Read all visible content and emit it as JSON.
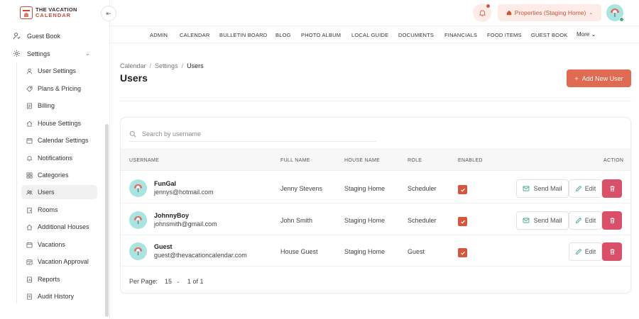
{
  "brand": {
    "line1": "THE VACATION",
    "line2": "CALENDAR"
  },
  "sidebar": {
    "top_items": [
      {
        "label": "Guest Book",
        "icon": "guest-book-icon"
      },
      {
        "label": "Settings",
        "icon": "gear-icon",
        "expanded": true
      }
    ],
    "sub_items": [
      {
        "label": "User Settings",
        "icon": "user-icon"
      },
      {
        "label": "Plans & Pricing",
        "icon": "tag-icon"
      },
      {
        "label": "Billing",
        "icon": "billing-icon"
      },
      {
        "label": "House Settings",
        "icon": "house-icon"
      },
      {
        "label": "Calendar Settings",
        "icon": "calendar-icon"
      },
      {
        "label": "Notifications",
        "icon": "bell-icon"
      },
      {
        "label": "Categories",
        "icon": "grid-icon"
      },
      {
        "label": "Users",
        "icon": "users-icon",
        "active": true
      },
      {
        "label": "Rooms",
        "icon": "room-icon"
      },
      {
        "label": "Additional Houses",
        "icon": "house-icon"
      },
      {
        "label": "Vacations",
        "icon": "calendar-icon"
      },
      {
        "label": "Vacation Approval",
        "icon": "check-calendar-icon"
      },
      {
        "label": "Reports",
        "icon": "report-icon"
      },
      {
        "label": "Audit History",
        "icon": "history-icon"
      }
    ]
  },
  "header": {
    "property_label": "Properties (Staging Home)",
    "menu": [
      "ADMIN",
      "CALENDAR",
      "BULLETIN BOARD",
      "BLOG",
      "PHOTO ALBUM",
      "LOCAL GUIDE",
      "DOCUMENTS",
      "FINANCIALS",
      "FOOD ITEMS",
      "GUEST BOOK"
    ],
    "more_label": "More"
  },
  "breadcrumb": [
    "Calendar",
    "Settings",
    "Users"
  ],
  "page_title": "Users",
  "add_button_label": "Add New User",
  "search": {
    "placeholder": "Search by username",
    "value": ""
  },
  "table": {
    "columns": [
      "USERNAME",
      "FULL NAME",
      "HOUSE NAME",
      "ROLE",
      "ENABLED",
      "ACTION"
    ],
    "rows": [
      {
        "username": "FunGal",
        "email": "jennys@hotmail.com",
        "full_name": "Jenny Stevens",
        "house": "Staging Home",
        "role": "Scheduler",
        "enabled": true,
        "actions": [
          "Send Mail",
          "Edit",
          "Delete"
        ]
      },
      {
        "username": "JohnnyBoy",
        "email": "johnsmith@gmail.com",
        "full_name": "John Smith",
        "house": "Staging Home",
        "role": "Scheduler",
        "enabled": true,
        "actions": [
          "Send Mail",
          "Edit",
          "Delete"
        ]
      },
      {
        "username": "Guest",
        "email": "guest@thevacationcalendar.com",
        "full_name": "House Guest",
        "house": "Staging Home",
        "role": "Guest",
        "enabled": true,
        "actions": [
          "Edit",
          "Delete"
        ]
      }
    ],
    "send_mail_label": "Send Mail",
    "edit_label": "Edit"
  },
  "pagination": {
    "per_page_label": "Per Page:",
    "per_page_value": "15",
    "page": "1",
    "of_label": "of",
    "total_pages": "1"
  },
  "colors": {
    "accent": "#df6b52",
    "danger": "#d8506a",
    "checkbox": "#d6563f",
    "avatar_bg": "#a9e4e0"
  }
}
